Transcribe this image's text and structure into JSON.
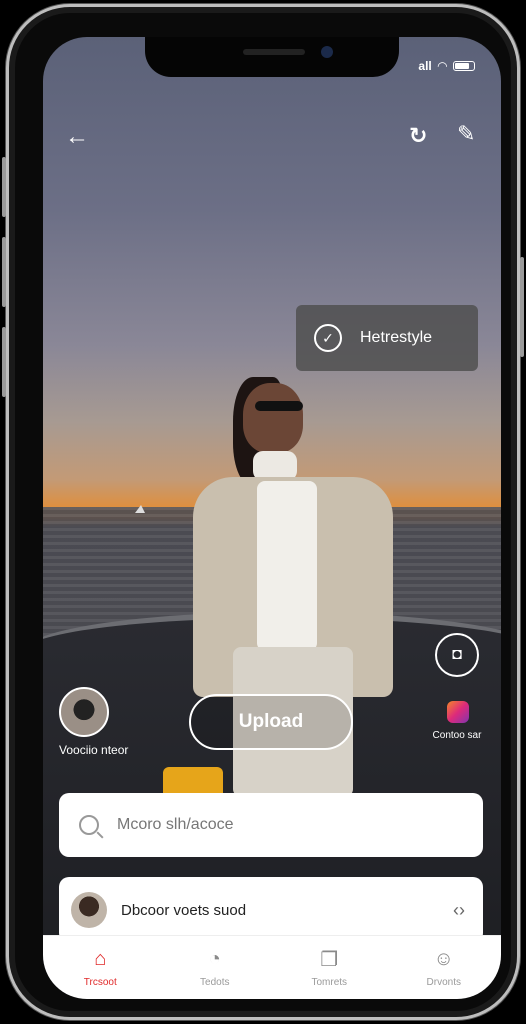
{
  "status_bar": {
    "signal": "all"
  },
  "header": {
    "back_icon": "back-arrow-icon",
    "right_icons": [
      "refresh-icon",
      "edit-icon"
    ]
  },
  "style_chip": {
    "label": "Hetrestyle"
  },
  "left_avatar": {
    "caption": "Voociio nteor"
  },
  "upload": {
    "label": "Upload"
  },
  "right_panel": {
    "caption": "Contoo sar"
  },
  "search": {
    "placeholder": "Mcoro slh/acoce"
  },
  "song": {
    "title": "Dbcoor voets suod"
  },
  "tabs": [
    {
      "label": "Trcsoot",
      "icon": "home-icon",
      "active": true
    },
    {
      "label": "Tedots",
      "icon": "activity-icon",
      "active": false
    },
    {
      "label": "Tomrets",
      "icon": "copy-icon",
      "active": false
    },
    {
      "label": "Drvonts",
      "icon": "profile-icon",
      "active": false
    }
  ],
  "colors": {
    "accent": "#e02a2a",
    "card_bg": "#ffffff"
  }
}
